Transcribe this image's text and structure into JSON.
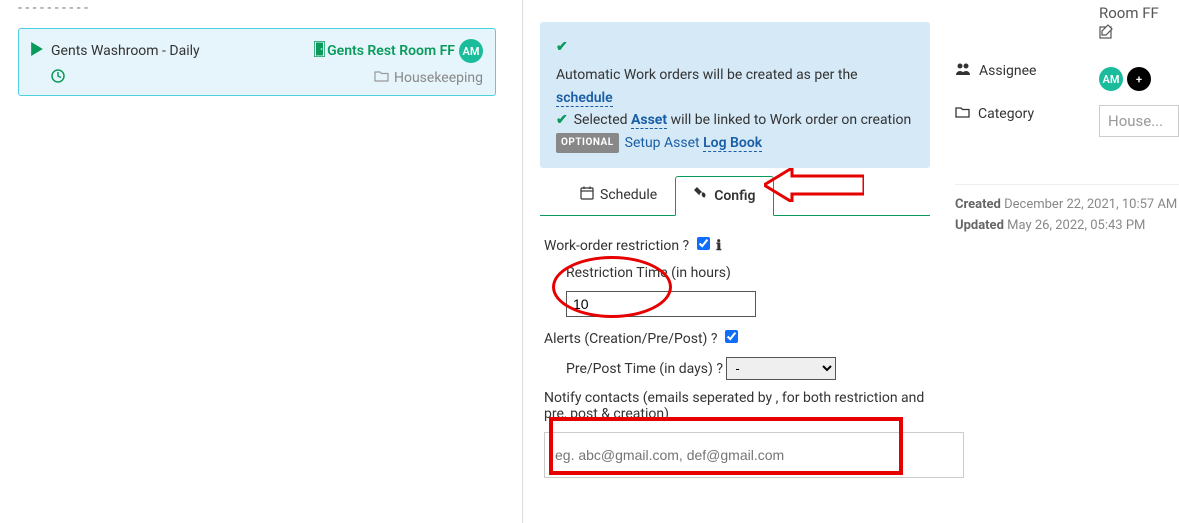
{
  "left": {
    "dashes": "- - - - - - - - - -",
    "title": "Gents Washroom - Daily",
    "asset_link": "Gents Rest Room FF",
    "avatar": "AM",
    "category": "Housekeeping"
  },
  "info": {
    "line1a": "Automatic Work orders will be created as per the",
    "schedule_link": "schedule",
    "line2a": "Selected",
    "asset_link": "Asset",
    "line2b": "will be linked to Work order on creation",
    "optional": "OPTIONAL",
    "line3a": "Setup Asset",
    "logbook_link": "Log Book"
  },
  "tabs": {
    "schedule": "Schedule",
    "config": "Config"
  },
  "form": {
    "restrict_label": "Work-order restriction ?",
    "restrict_time_label": "Restriction Time (in hours)",
    "restrict_value": "10",
    "alerts_label": "Alerts (Creation/Pre/Post) ?",
    "prepost_label": "Pre/Post Time (in days) ?",
    "prepost_value": "-",
    "notify_label": "Notify contacts (emails seperated by , for both restriction and pre, post & creation)",
    "notify_placeholder": "eg. abc@gmail.com, def@gmail.com"
  },
  "right": {
    "cut_title": "Room FF",
    "assignee_label": "Assignee",
    "category_label": "Category",
    "avatar": "AM",
    "plus": "+",
    "category_value": "House...",
    "created_label": "Created",
    "created_value": "December 22, 2021, 10:57 AM",
    "updated_label": "Updated",
    "updated_value": "May 26, 2022, 05:43 PM"
  }
}
